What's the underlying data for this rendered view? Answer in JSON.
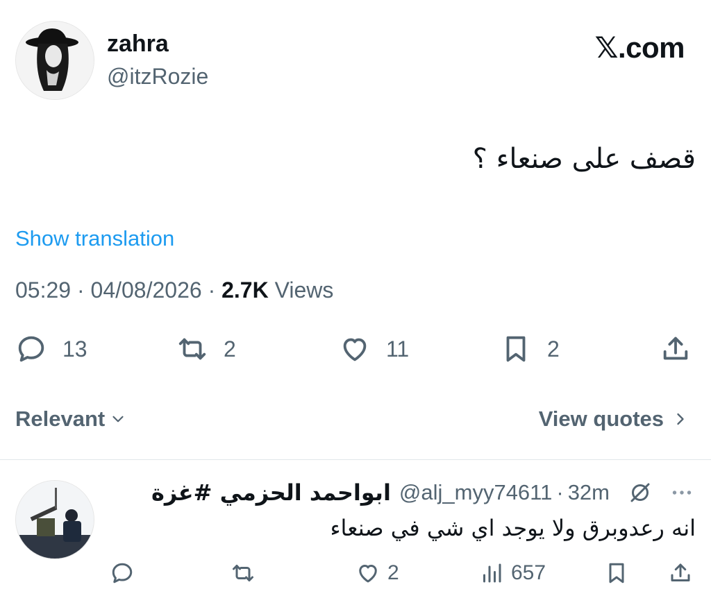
{
  "tweet": {
    "author": {
      "display_name": "zahra",
      "handle": "@itzRozie"
    },
    "brand": "𝕏.com",
    "text": "قصف على صنعاء ؟",
    "show_translation": "Show translation",
    "time": "05:29",
    "date": "04/08/2026",
    "separator": "·",
    "views_count": "2.7K",
    "views_label": "Views",
    "actions": {
      "replies": "13",
      "reposts": "2",
      "likes": "11",
      "bookmarks": "2"
    }
  },
  "filters": {
    "sort_label": "Relevant",
    "view_quotes": "View quotes"
  },
  "reply": {
    "display_name": "ابواحمد الحزمي #غزة",
    "handle": "@alj_myy74611",
    "separator": "·",
    "time": "32m",
    "text": "انه رعدوبرق  ولا يوجد اي شي في صنعاء",
    "actions": {
      "likes": "2",
      "views": "657"
    }
  },
  "colors": {
    "link": "#1d9bf0",
    "secondary_text": "#536471",
    "primary_text": "#0f1419"
  }
}
